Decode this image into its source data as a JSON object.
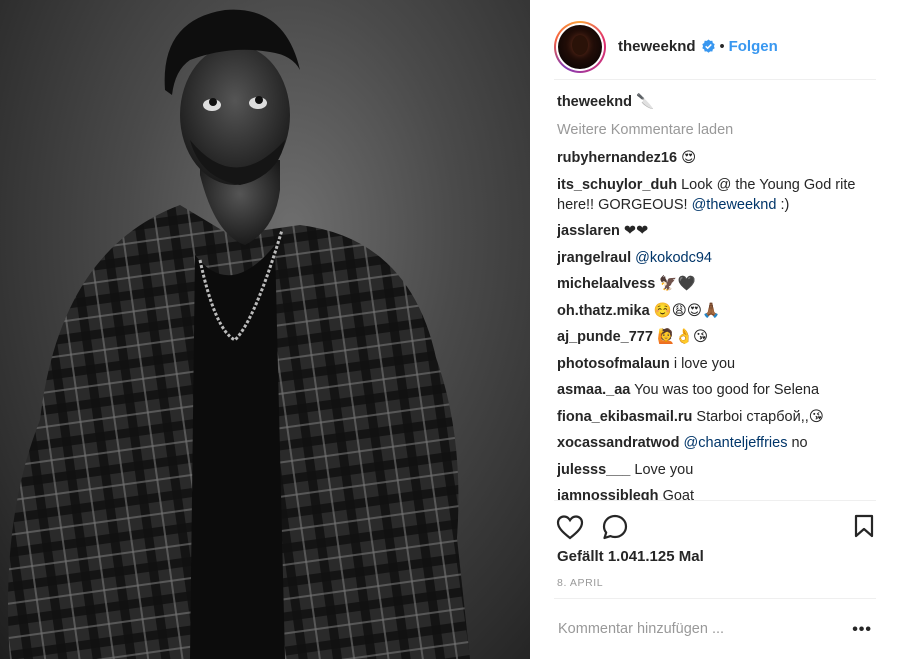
{
  "post": {
    "photo_icon": "portrait-photo"
  },
  "header": {
    "username": "theweeknd",
    "verified_icon": "verified-badge-icon",
    "separator": "•",
    "follow_label": "Folgen"
  },
  "caption": {
    "username": "theweeknd",
    "text": "🔪"
  },
  "load_more_label": "Weitere Kommentare laden",
  "comments": [
    {
      "user": "rubyhernandez16",
      "text": "😍"
    },
    {
      "user": "its_schuylor_duh",
      "text": "Look @ the Young God rite here!! GORGEOUS!",
      "mention": "@theweeknd",
      "after": ":)"
    },
    {
      "user": "jasslaren",
      "text": "❤❤"
    },
    {
      "user": "jrangelraul",
      "text": "",
      "mention": "@kokodc94",
      "after": ""
    },
    {
      "user": "michelaalvess",
      "text": "🦅🖤"
    },
    {
      "user": "oh.thatz.mika",
      "text": "☺️😩😍🙏🏾"
    },
    {
      "user": "aj_punde_777",
      "text": "🙋👌😘"
    },
    {
      "user": "photosofmalaun",
      "text": "i love you"
    },
    {
      "user": "asmaa._aa",
      "text": "You was too good for Selena"
    },
    {
      "user": "fiona_ekibasmail.ru",
      "text": "Starboi старбой,,😘"
    },
    {
      "user": "xocassandratwod",
      "text": "",
      "mention": "@chanteljeffries",
      "after": "no"
    },
    {
      "user": "julesss___",
      "text": "Love you"
    },
    {
      "user": "iamnossiblegh",
      "text": "Goat"
    }
  ],
  "actions": {
    "like_icon": "heart-icon",
    "comment_icon": "comment-bubble-icon",
    "save_icon": "bookmark-icon"
  },
  "likes_text": "Gefällt 1.041.125 Mal",
  "date_text": "8. APRIL",
  "add_comment_placeholder": "Kommentar hinzufügen ...",
  "more_label": "•••",
  "colors": {
    "accent": "#3897f0",
    "mention": "#003569",
    "muted": "#999999",
    "text": "#262626"
  }
}
